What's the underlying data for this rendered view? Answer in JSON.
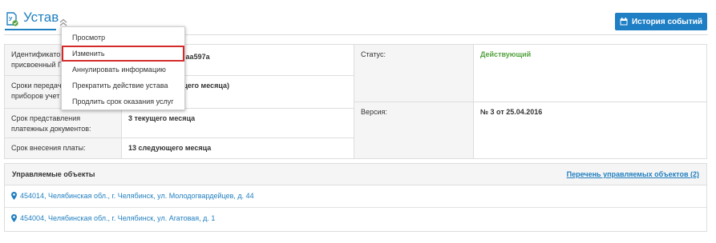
{
  "header": {
    "title": "Устав",
    "history_button": "История событий"
  },
  "details": {
    "id_label": "Идентификатор, присвоенный ГИС ЖКХ:",
    "id_label_visible": "Идентификато\nприсвоенный Г",
    "id_value": "...31-875f-2a1870aa597a",
    "meters_label": "Сроки передачи показаний приборов учета:",
    "meters_label_visible": "Сроки передач\nприборов учет",
    "meters_value": "сяца) - 25 (текущего месяца)",
    "docs_label": "Срок представления платежных документов:",
    "docs_value": "3 текущего месяца",
    "payment_label": "Срок внесения платы:",
    "payment_value": "13 следующего месяца",
    "status_label": "Статус:",
    "status_value": "Действующий",
    "version_label": "Версия:",
    "version_value": "№ 3 от 25.04.2016"
  },
  "objects": {
    "title": "Управляемые объекты",
    "link": "Перечень управляемых объектов (2)",
    "rows": [
      "454014, Челябинская обл., г. Челябинск, ул. Молодогвардейцев, д. 44",
      "454004, Челябинская обл., г. Челябинск, ул. Агатовая, д. 1"
    ]
  },
  "menu": {
    "items": [
      "Просмотр",
      "Изменить",
      "Аннулировать информацию",
      "Прекратить действие устава",
      "Продлить срок оказания услуг"
    ],
    "active_item": "Изменить"
  },
  "colors": {
    "accent": "#1f7fc0",
    "button": "#1e7fc5",
    "status_green": "#53a23e",
    "highlight_red": "#d42a2a"
  }
}
